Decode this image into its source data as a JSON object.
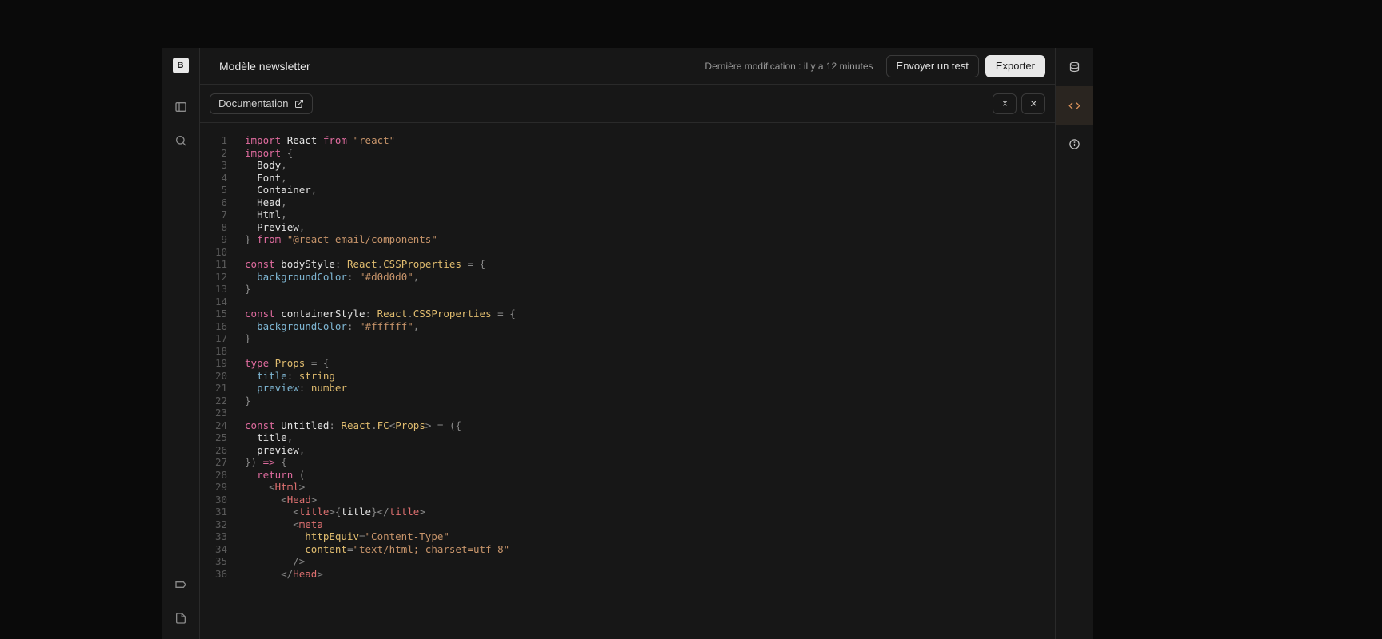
{
  "logo": "B",
  "header": {
    "title": "Modèle newsletter",
    "lastModifiedLabel": "Dernière modification :",
    "lastModifiedValue": "il y a 12 minutes",
    "sendTest": "Envoyer un test",
    "export": "Exporter"
  },
  "toolbar": {
    "documentation": "Documentation"
  },
  "code": {
    "lineCount": 36,
    "tokens": [
      [
        [
          "kw",
          "import"
        ],
        [
          "",
          " "
        ],
        [
          "id",
          "React"
        ],
        [
          "",
          " "
        ],
        [
          "kw",
          "from"
        ],
        [
          "",
          " "
        ],
        [
          "str",
          "\"react\""
        ]
      ],
      [
        [
          "kw",
          "import"
        ],
        [
          "",
          " "
        ],
        [
          "punc",
          "{"
        ]
      ],
      [
        [
          "",
          "  "
        ],
        [
          "id",
          "Body"
        ],
        [
          "punc",
          ","
        ]
      ],
      [
        [
          "",
          "  "
        ],
        [
          "id",
          "Font"
        ],
        [
          "punc",
          ","
        ]
      ],
      [
        [
          "",
          "  "
        ],
        [
          "id",
          "Container"
        ],
        [
          "punc",
          ","
        ]
      ],
      [
        [
          "",
          "  "
        ],
        [
          "id",
          "Head"
        ],
        [
          "punc",
          ","
        ]
      ],
      [
        [
          "",
          "  "
        ],
        [
          "id",
          "Html"
        ],
        [
          "punc",
          ","
        ]
      ],
      [
        [
          "",
          "  "
        ],
        [
          "id",
          "Preview"
        ],
        [
          "punc",
          ","
        ]
      ],
      [
        [
          "punc",
          "}"
        ],
        [
          "",
          " "
        ],
        [
          "kw",
          "from"
        ],
        [
          "",
          " "
        ],
        [
          "str",
          "\"@react-email/components\""
        ]
      ],
      [],
      [
        [
          "kw",
          "const"
        ],
        [
          "",
          " "
        ],
        [
          "id",
          "bodyStyle"
        ],
        [
          "punc",
          ":"
        ],
        [
          "",
          " "
        ],
        [
          "type",
          "React"
        ],
        [
          "punc",
          "."
        ],
        [
          "type",
          "CSSProperties"
        ],
        [
          "",
          " "
        ],
        [
          "punc",
          "="
        ],
        [
          "",
          " "
        ],
        [
          "punc",
          "{"
        ]
      ],
      [
        [
          "",
          "  "
        ],
        [
          "prop",
          "backgroundColor"
        ],
        [
          "punc",
          ":"
        ],
        [
          "",
          " "
        ],
        [
          "str",
          "\"#d0d0d0\""
        ],
        [
          "punc",
          ","
        ]
      ],
      [
        [
          "punc",
          "}"
        ]
      ],
      [],
      [
        [
          "kw",
          "const"
        ],
        [
          "",
          " "
        ],
        [
          "id",
          "containerStyle"
        ],
        [
          "punc",
          ":"
        ],
        [
          "",
          " "
        ],
        [
          "type",
          "React"
        ],
        [
          "punc",
          "."
        ],
        [
          "type",
          "CSSProperties"
        ],
        [
          "",
          " "
        ],
        [
          "punc",
          "="
        ],
        [
          "",
          " "
        ],
        [
          "punc",
          "{"
        ]
      ],
      [
        [
          "",
          "  "
        ],
        [
          "prop",
          "backgroundColor"
        ],
        [
          "punc",
          ":"
        ],
        [
          "",
          " "
        ],
        [
          "str",
          "\"#ffffff\""
        ],
        [
          "punc",
          ","
        ]
      ],
      [
        [
          "punc",
          "}"
        ]
      ],
      [],
      [
        [
          "kw",
          "type"
        ],
        [
          "",
          " "
        ],
        [
          "type",
          "Props"
        ],
        [
          "",
          " "
        ],
        [
          "punc",
          "="
        ],
        [
          "",
          " "
        ],
        [
          "punc",
          "{"
        ]
      ],
      [
        [
          "",
          "  "
        ],
        [
          "prop",
          "title"
        ],
        [
          "punc",
          ":"
        ],
        [
          "",
          " "
        ],
        [
          "type",
          "string"
        ]
      ],
      [
        [
          "",
          "  "
        ],
        [
          "prop",
          "preview"
        ],
        [
          "punc",
          ":"
        ],
        [
          "",
          " "
        ],
        [
          "type",
          "number"
        ]
      ],
      [
        [
          "punc",
          "}"
        ]
      ],
      [],
      [
        [
          "kw",
          "const"
        ],
        [
          "",
          " "
        ],
        [
          "id",
          "Untitled"
        ],
        [
          "punc",
          ":"
        ],
        [
          "",
          " "
        ],
        [
          "type",
          "React"
        ],
        [
          "punc",
          "."
        ],
        [
          "type",
          "FC"
        ],
        [
          "punc",
          "<"
        ],
        [
          "type",
          "Props"
        ],
        [
          "punc",
          ">"
        ],
        [
          "",
          " "
        ],
        [
          "punc",
          "="
        ],
        [
          "",
          " "
        ],
        [
          "punc",
          "({"
        ]
      ],
      [
        [
          "",
          "  "
        ],
        [
          "id",
          "title"
        ],
        [
          "punc",
          ","
        ]
      ],
      [
        [
          "",
          "  "
        ],
        [
          "id",
          "preview"
        ],
        [
          "punc",
          ","
        ]
      ],
      [
        [
          "punc",
          "})"
        ],
        [
          "",
          " "
        ],
        [
          "kw",
          "=>"
        ],
        [
          "",
          " "
        ],
        [
          "punc",
          "{"
        ]
      ],
      [
        [
          "",
          "  "
        ],
        [
          "kw",
          "return"
        ],
        [
          "",
          " "
        ],
        [
          "punc",
          "("
        ]
      ],
      [
        [
          "",
          "    "
        ],
        [
          "punc",
          "<"
        ],
        [
          "tag",
          "Html"
        ],
        [
          "punc",
          ">"
        ]
      ],
      [
        [
          "",
          "      "
        ],
        [
          "punc",
          "<"
        ],
        [
          "tag",
          "Head"
        ],
        [
          "punc",
          ">"
        ]
      ],
      [
        [
          "",
          "        "
        ],
        [
          "punc",
          "<"
        ],
        [
          "tag",
          "title"
        ],
        [
          "punc",
          ">"
        ],
        [
          "punc",
          "{"
        ],
        [
          "id",
          "title"
        ],
        [
          "punc",
          "}"
        ],
        [
          "punc",
          "</"
        ],
        [
          "tag",
          "title"
        ],
        [
          "punc",
          ">"
        ]
      ],
      [
        [
          "",
          "        "
        ],
        [
          "punc",
          "<"
        ],
        [
          "tag",
          "meta"
        ]
      ],
      [
        [
          "",
          "          "
        ],
        [
          "attr",
          "httpEquiv"
        ],
        [
          "punc",
          "="
        ],
        [
          "str",
          "\"Content-Type\""
        ]
      ],
      [
        [
          "",
          "          "
        ],
        [
          "attr",
          "content"
        ],
        [
          "punc",
          "="
        ],
        [
          "str",
          "\"text/html; charset=utf-8\""
        ]
      ],
      [
        [
          "",
          "        "
        ],
        [
          "punc",
          "/>"
        ]
      ],
      [
        [
          "",
          "      "
        ],
        [
          "punc",
          "</"
        ],
        [
          "tag",
          "Head"
        ],
        [
          "punc",
          ">"
        ]
      ]
    ]
  }
}
